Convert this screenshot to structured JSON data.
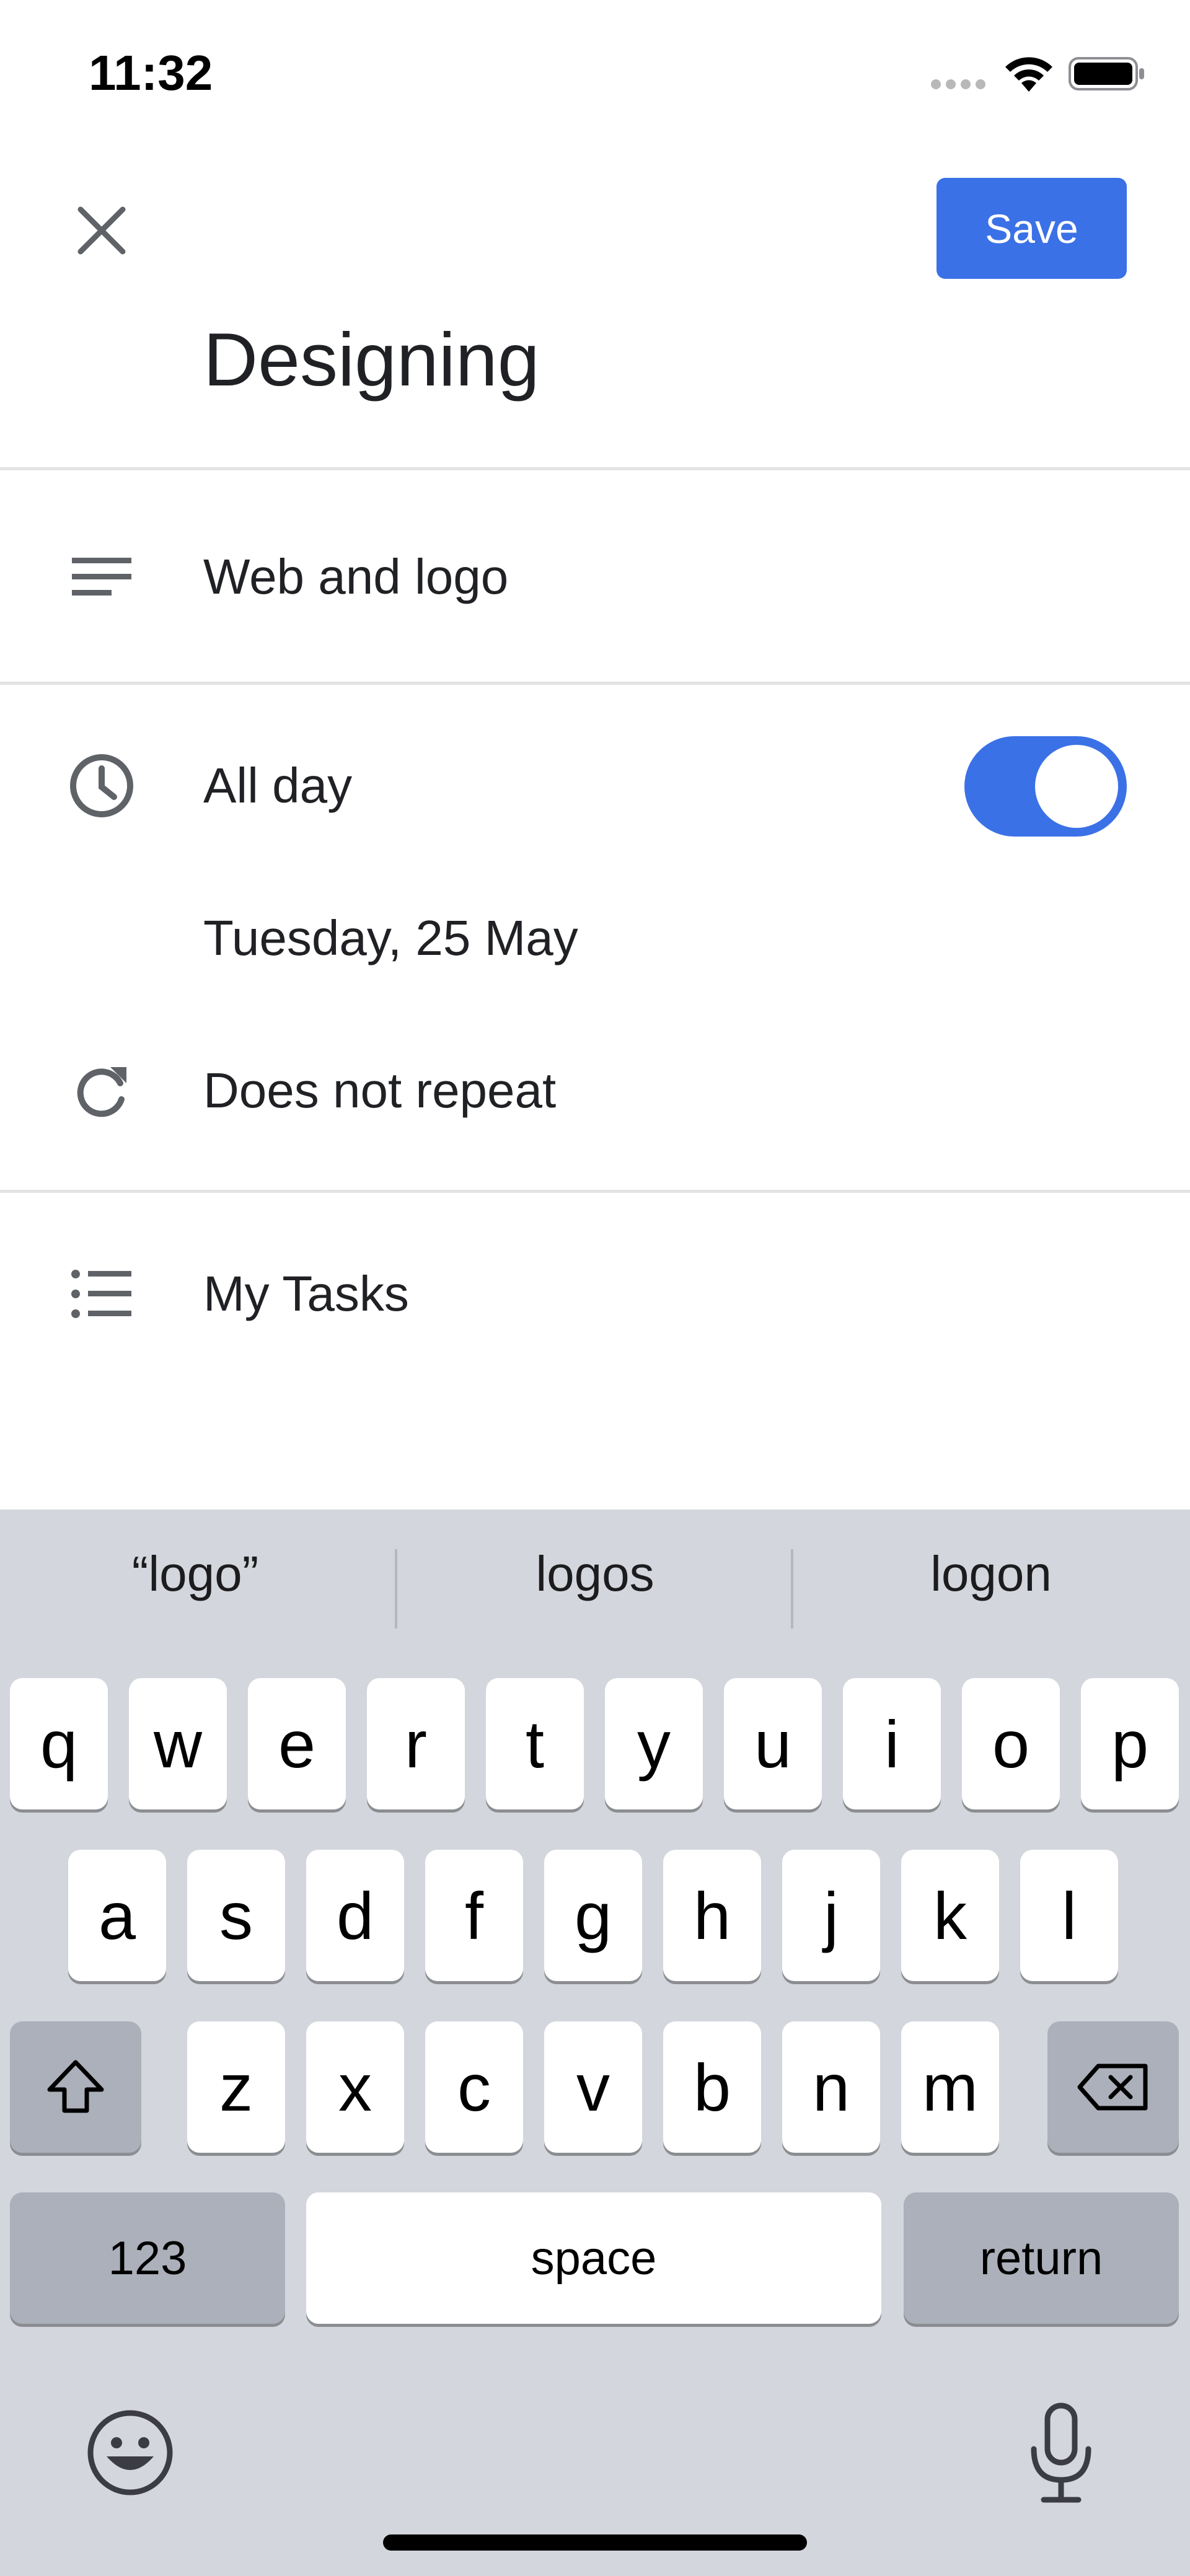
{
  "status_bar": {
    "time": "11:32"
  },
  "header": {
    "save_label": "Save",
    "title": "Designing"
  },
  "rows": {
    "description": "Web and logo",
    "all_day": "All day",
    "all_day_on": true,
    "date": "Tuesday, 25 May",
    "repeat": "Does not repeat",
    "task_list": "My Tasks"
  },
  "colors": {
    "accent": "#3b71e6",
    "keyboard_bg": "#d3d6dc"
  },
  "keyboard": {
    "suggestions": [
      "“logo”",
      "logos",
      "logon"
    ],
    "row1": [
      "q",
      "w",
      "e",
      "r",
      "t",
      "y",
      "u",
      "i",
      "o",
      "p"
    ],
    "row2": [
      "a",
      "s",
      "d",
      "f",
      "g",
      "h",
      "j",
      "k",
      "l"
    ],
    "row3": [
      "z",
      "x",
      "c",
      "v",
      "b",
      "n",
      "m"
    ],
    "numbers_label": "123",
    "space_label": "space",
    "return_label": "return"
  }
}
